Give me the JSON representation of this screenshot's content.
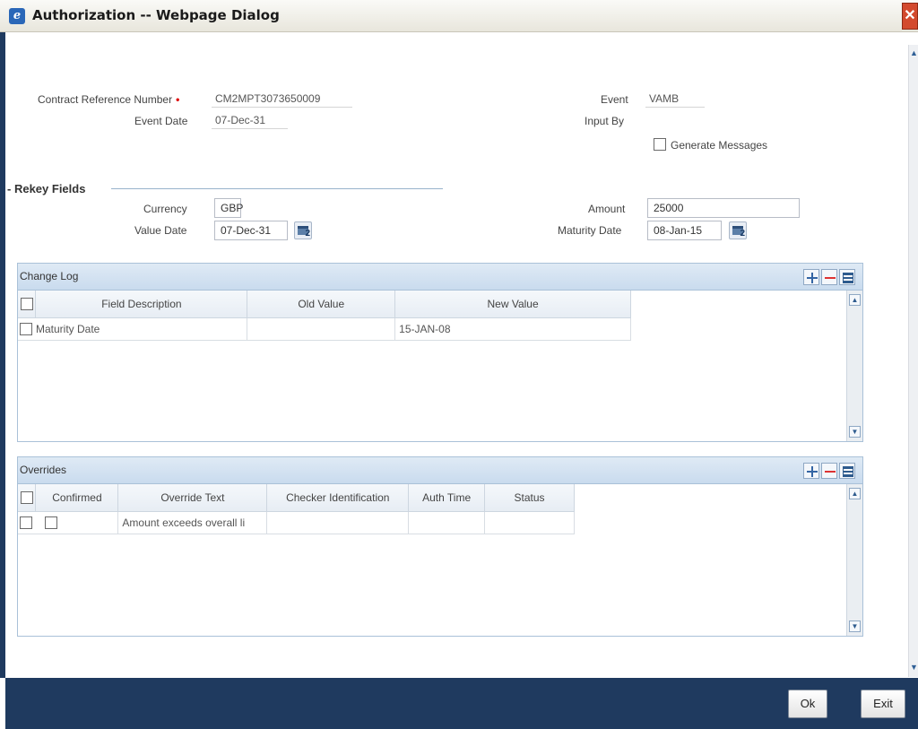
{
  "window": {
    "title": "Authorization -- Webpage Dialog",
    "close_glyph": "✕",
    "icon": "ie-icon"
  },
  "fields": {
    "contract_ref_label": "Contract Reference Number",
    "contract_ref_value": "CM2MPT3073650009",
    "event_date_label": "Event Date",
    "event_date_value": "07-Dec-31",
    "event_label": "Event",
    "event_value": "VAMB",
    "input_by_label": "Input By",
    "input_by_value": "",
    "generate_messages_label": "Generate Messages"
  },
  "rekey": {
    "section_title": "Rekey Fields",
    "currency_label": "Currency",
    "currency_value": "GBP",
    "value_date_label": "Value Date",
    "value_date_value": "07-Dec-31",
    "amount_label": "Amount",
    "amount_value": "25000",
    "maturity_date_label": "Maturity Date",
    "maturity_date_value": "08-Jan-15"
  },
  "change_log": {
    "title": "Change Log",
    "columns": [
      "Field Description",
      "Old Value",
      "New Value"
    ],
    "rows": [
      {
        "field": "Maturity Date",
        "old": "",
        "new": "15-JAN-08"
      }
    ]
  },
  "overrides": {
    "title": "Overrides",
    "columns": [
      "Confirmed",
      "Override Text",
      "Checker Identification",
      "Auth Time",
      "Status"
    ],
    "rows": [
      {
        "text": "Amount exceeds overall li",
        "checker": "",
        "auth_time": "",
        "status": ""
      }
    ]
  },
  "footer": {
    "ok_label": "Ok",
    "exit_label": "Exit"
  },
  "colors": {
    "footer_bg": "#1f3a5f",
    "required": "#dd0000",
    "grid_header": "#c9dbee"
  }
}
